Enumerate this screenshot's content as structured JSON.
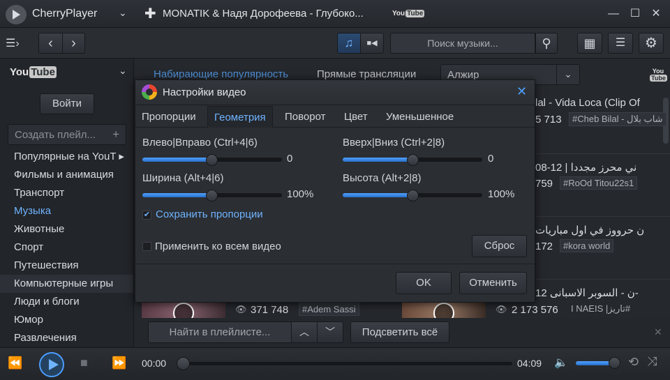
{
  "titlebar": {
    "app_name": "CherryPlayer",
    "menu_chevron": "⌄",
    "new_tab": "✚",
    "track_title": "MONATIK & Надя Дорофеева - Глубоко...",
    "yt_you": "You",
    "yt_tube": "Tube",
    "minimize": "—",
    "maximize": "☐",
    "close": "✕"
  },
  "toolbar": {
    "menu_icon": "☰›",
    "back": "‹",
    "forward": "›",
    "music_icon": "♫",
    "video_icon": "■◀",
    "search_placeholder": "Поиск музыки...",
    "search_icon": "⚲",
    "grid_icon": "▦",
    "list_icon": "☰",
    "settings_icon": "⚙"
  },
  "sidebar": {
    "source_you": "You",
    "source_tube": "Tube",
    "source_chevron": "⌄",
    "login": "Войти",
    "create_playlist": "Создать плейл...",
    "create_plus": "+",
    "categories": [
      "Популярные на YouT ▸",
      "Фильмы и анимация",
      "Транспорт",
      "Музыка",
      "Животные",
      "Спорт",
      "Путешествия",
      "Компьютерные игры",
      "Люди и блоги",
      "Юмор",
      "Развлечения"
    ]
  },
  "content": {
    "tab_trending": "Набирающие популярность",
    "tab_live": "Прямые трансляции",
    "region": "Алжир",
    "region_chevron": "⌄",
    "rows": [
      {
        "title": "lal - Vida Loca (Clip Of",
        "views": "5 713",
        "tag": "#Cheb Bilal - شاب بلال"
      },
      {
        "title": "08-12 | ني محرز مجددا",
        "views": "759",
        "tag": "#RoOd Titou22s1"
      },
      {
        "title": "ن حرووز في اول مباريات",
        "views": "172",
        "tag": "#kora world"
      },
      {
        "title": "ن - السوبر الاسبانى 12-",
        "views": "",
        "tag": ""
      }
    ],
    "bottom_left_views": "371 748",
    "bottom_left_tag": "#Adem Sassi",
    "bottom_right_views": "2 173 576",
    "bottom_right_tag": "I NAEIS |تاريز#",
    "eye_icon": "👁"
  },
  "playlist_bar": {
    "find_placeholder": "Найти в плейлисте...",
    "up": "︿",
    "down": "﹀",
    "highlight_all": "Подсветить всё",
    "close": "✕"
  },
  "player": {
    "prev": "⏪",
    "stop": "■",
    "next": "⏩",
    "time_current": "00:00",
    "time_total": "04:09",
    "volume_icon": "🔈",
    "repeat_icon": "⟲",
    "shuffle_icon": "⤨",
    "progress": 0.0,
    "volume": 0.93
  },
  "dialog": {
    "title": "Настройки видео",
    "close": "✕",
    "tabs": [
      "Пропорции",
      "Геометрия",
      "Поворот",
      "Цвет",
      "Уменьшенное"
    ],
    "active_tab": "Геометрия",
    "sliders": [
      {
        "label": "Влево|Вправо (Ctrl+4|6)",
        "value_text": "0",
        "level": 0.5
      },
      {
        "label": "Вверх|Вниз (Ctrl+2|8)",
        "value_text": "0",
        "level": 0.5
      },
      {
        "label": "Ширина (Alt+4|6)",
        "value_text": "100%",
        "level": 0.5
      },
      {
        "label": "Высота (Alt+2|8)",
        "value_text": "100%",
        "level": 0.5
      }
    ],
    "keep_proportions": "Сохранить пропорции",
    "keep_proportions_checked": true,
    "apply_all": "Применить ко всем видео",
    "apply_all_checked": false,
    "reset": "Сброс",
    "ok": "OK",
    "cancel": "Отменить"
  },
  "colors": {
    "accent": "#6fb3ff",
    "background": "#23262b"
  }
}
